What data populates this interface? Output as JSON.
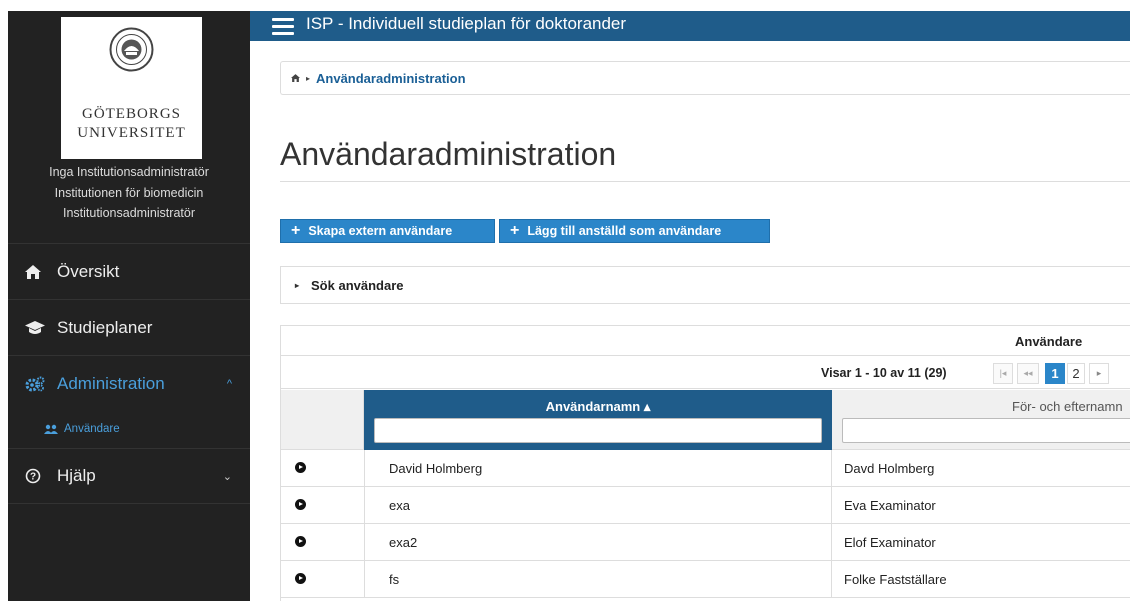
{
  "app": {
    "title": "ISP - Individuell studieplan för doktorander"
  },
  "sidebar": {
    "logo": {
      "line1": "GÖTEBORGS",
      "line2": "UNIVERSITET"
    },
    "user": {
      "name": "Inga Institutionsadministratör",
      "department": "Institutionen för biomedicin",
      "role": "Institutionsadministratör"
    },
    "menu": [
      {
        "label": "Översikt",
        "icon": "home-icon"
      },
      {
        "label": "Studieplaner",
        "icon": "graduation-cap-icon"
      },
      {
        "label": "Administration",
        "icon": "gears-icon",
        "expanded": true,
        "chevron": "^"
      },
      {
        "label": "Hjälp",
        "icon": "question-circle-icon",
        "chevron": "⌄"
      }
    ],
    "submenu": [
      {
        "label": "Användare",
        "icon": "users-icon",
        "active": true
      }
    ],
    "active_color": "#4a9fdc"
  },
  "breadcrumb": {
    "items": [
      "Användaradministration"
    ]
  },
  "page": {
    "title": "Användaradministration"
  },
  "buttons": {
    "create_external": "Skapa extern användare",
    "add_employee": "Lägg till anställd som användare"
  },
  "search_panel": {
    "label": "Sök användare"
  },
  "table": {
    "caption": "Användare",
    "page_report": "Visar 1 - 10 av 11  (29)",
    "pages": [
      "1",
      "2"
    ],
    "current_page": "1",
    "columns": {
      "username": "Användarnamn ▴",
      "fullname": "För- och efternamn"
    },
    "rows": [
      {
        "username": "David Holmberg",
        "fullname": "Davd Holmberg"
      },
      {
        "username": "exa",
        "fullname": "Eva Examinator"
      },
      {
        "username": "exa2",
        "fullname": "Elof Examinator"
      },
      {
        "username": "fs",
        "fullname": "Folke Fastställare"
      }
    ]
  },
  "colors": {
    "topbar": "#1f5c8a",
    "sidebar": "#222222",
    "primary": "#2b86c9"
  }
}
